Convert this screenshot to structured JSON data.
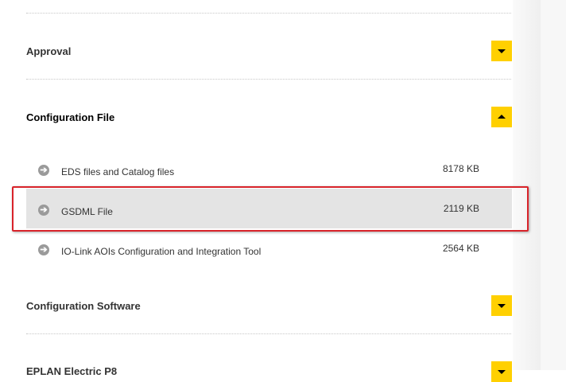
{
  "sections": [
    {
      "title": "Approval",
      "expanded": false
    },
    {
      "title": "Configuration File",
      "expanded": true
    },
    {
      "title": "Configuration Software",
      "expanded": false
    },
    {
      "title": "EPLAN Electric P8",
      "expanded": false
    }
  ],
  "files": [
    {
      "name": "EDS files and Catalog files",
      "size": "8178 KB",
      "icon": "arrow-right-circle-icon"
    },
    {
      "name": "GSDML File",
      "size": "2119 KB",
      "icon": "arrow-right-circle-icon",
      "selected": true
    },
    {
      "name": "IO-Link AOIs Configuration and Integration Tool",
      "size": "2564 KB",
      "icon": "arrow-right-circle-icon"
    }
  ],
  "colors": {
    "accent_toggle": "#ffd000",
    "highlight_border": "#d8232a",
    "selected_row_bg": "#e4e4e4"
  }
}
